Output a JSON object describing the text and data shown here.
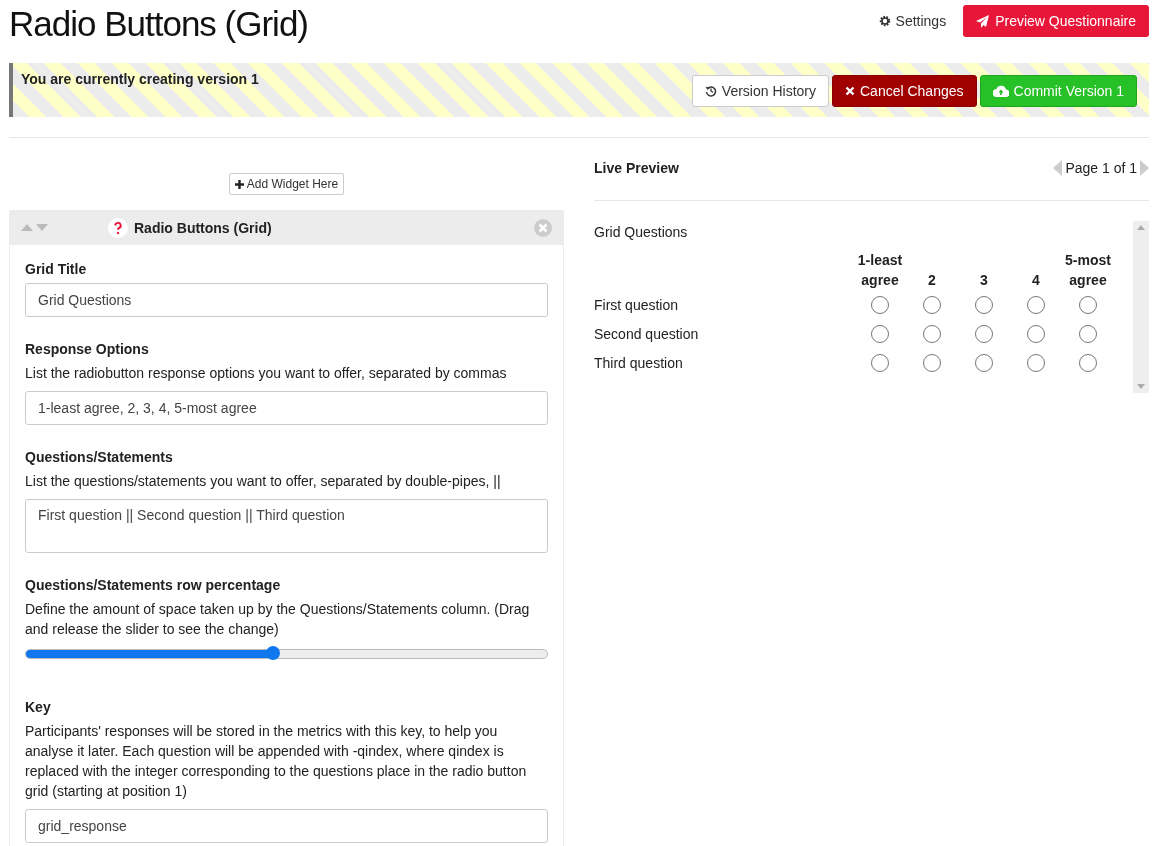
{
  "page_title": "Radio Buttons (Grid)",
  "header_actions": [
    {
      "kind": "link",
      "label": "Settings"
    },
    {
      "kind": "primary",
      "label": "Preview Questionnaire"
    }
  ],
  "version_banner": {
    "message": "You are currently creating version 1",
    "buttons": [
      {
        "kind": "default",
        "label": "Version History"
      },
      {
        "kind": "danger",
        "label": "Cancel Changes"
      },
      {
        "kind": "success",
        "label": "Commit Version 1"
      }
    ]
  },
  "add_widget": "Add Widget Here",
  "widget": {
    "title": "Radio Buttons (Grid)",
    "fields": [
      {
        "kind": "input",
        "label": "Grid Title",
        "value": "Grid Questions"
      },
      {
        "kind": "input",
        "label": "Response Options",
        "help": "List the radiobutton response options you want to offer, separated by commas",
        "value": "1-least agree, 2, 3, 4, 5-most agree"
      },
      {
        "kind": "textarea",
        "label": "Questions/Statements",
        "help": "List the questions/statements you want to offer, separated by double-pipes, ||",
        "value": "First question || Second question || Third question"
      },
      {
        "kind": "slider",
        "label": "Questions/Statements row percentage",
        "help": "Define the amount of space taken up by the Questions/Statements column. (Drag and release the slider to see the change)",
        "level": 0.475
      },
      {
        "kind": "input",
        "label": "Key",
        "help": "Participants' responses will be stored in the metrics with this key, to help you analyse it later. Each question will be appended with -qindex, where qindex is replaced with the integer corresponding to the questions place in the radio button grid (starting at position 1)",
        "value": "grid_response"
      }
    ]
  },
  "preview": {
    "heading": "Live Preview",
    "pager": "Page 1 of 1",
    "grid_title": "Grid Questions",
    "columns": [
      "1-least agree",
      "2",
      "3",
      "4",
      "5-most agree"
    ],
    "rows": [
      {
        "label": "First question",
        "checked": [
          false,
          false,
          false,
          false,
          false
        ]
      },
      {
        "label": "Second question",
        "checked": [
          false,
          false,
          false,
          false,
          false
        ]
      },
      {
        "label": "Third question",
        "checked": [
          false,
          false,
          false,
          false,
          false
        ]
      }
    ]
  }
}
